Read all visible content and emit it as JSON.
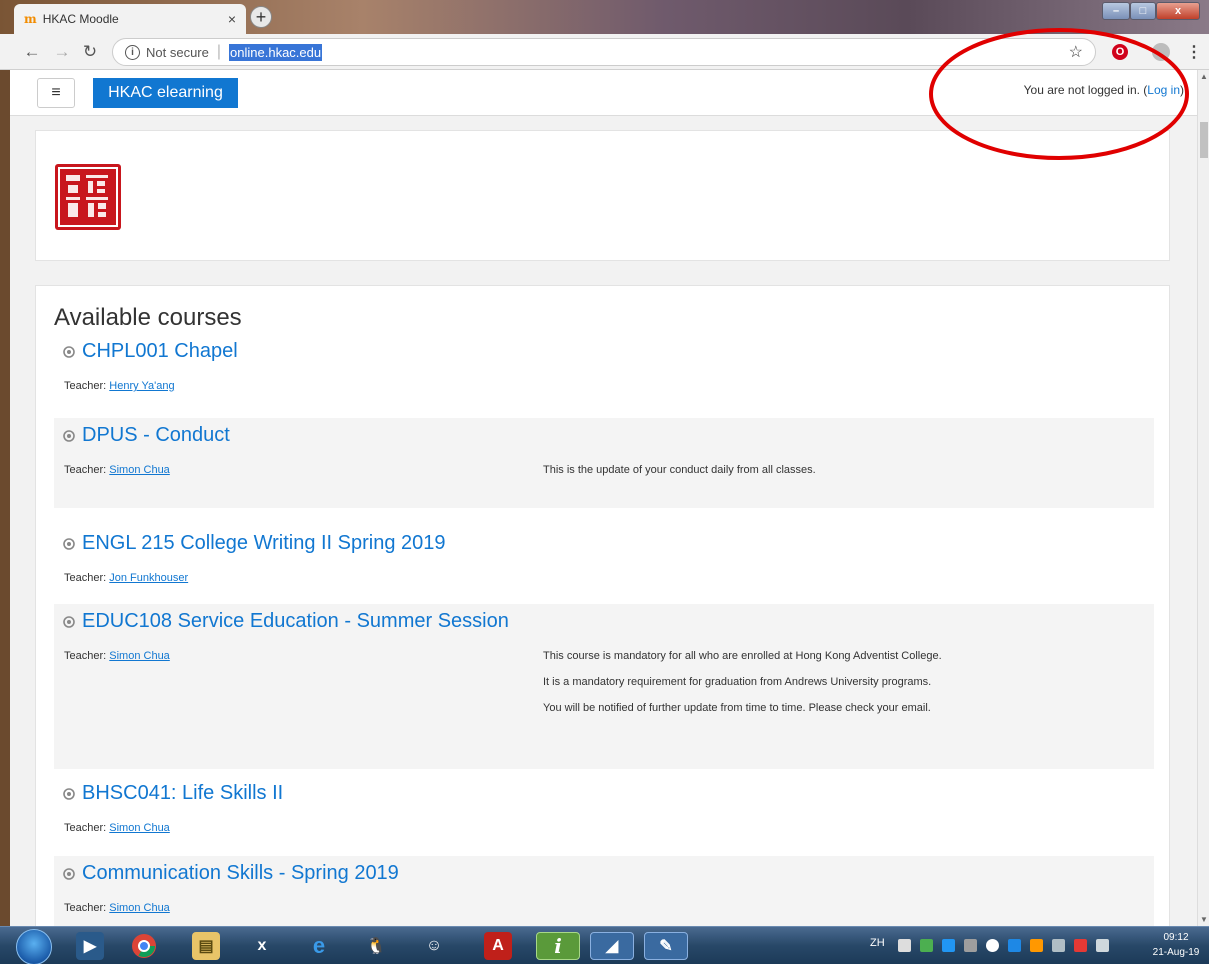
{
  "browser": {
    "tab_title": "HKAC Moodle",
    "tab_close": "×",
    "new_tab": "+",
    "security_label": "Not secure",
    "url": "online.hkac.edu",
    "min_label": "–",
    "max_label": "□",
    "close_label": "x"
  },
  "navbar": {
    "menu_icon": "≡",
    "brand": "HKAC elearning",
    "login_prefix": "You are not logged in. (",
    "login_link": "Log in",
    "login_suffix": ")"
  },
  "main": {
    "title": "Available courses",
    "teacher_label": "Teacher:",
    "courses": [
      {
        "name": "CHPL001 Chapel",
        "teacher": "Henry Ya'ang",
        "summary": []
      },
      {
        "name": "DPUS - Conduct",
        "teacher": "Simon Chua",
        "summary": [
          "This is the update of your conduct daily from all classes."
        ]
      },
      {
        "name": "ENGL 215 College Writing II Spring 2019",
        "teacher": "Jon Funkhouser",
        "summary": []
      },
      {
        "name": "EDUC108 Service Education - Summer Session",
        "teacher": "Simon Chua",
        "summary": [
          "This course is mandatory for all who are enrolled at Hong Kong Adventist College.",
          "It is a mandatory requirement for graduation from Andrews University programs.",
          "You will be notified of further update from time to time.  Please check your email."
        ]
      },
      {
        "name": "BHSC041: Life Skills II",
        "teacher": "Simon Chua",
        "summary": []
      },
      {
        "name": "Communication Skills - Spring 2019",
        "teacher": "Simon Chua",
        "summary": []
      }
    ]
  },
  "taskbar": {
    "language": "ZH",
    "time": "09:12",
    "date": "21-Aug-19",
    "excel_label": "x",
    "pdf_label": "A",
    "info_label": "i"
  },
  "colors": {
    "brand": "#1177d1",
    "link": "#1177d1",
    "seal_red": "#c8161d",
    "annotation_circle": "#e00000"
  }
}
